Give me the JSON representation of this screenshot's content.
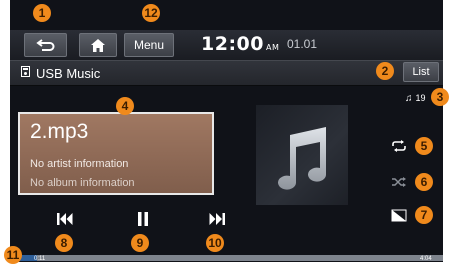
{
  "topbar": {
    "menu_label": "Menu",
    "clock_time": "12:00",
    "clock_ampm": "AM",
    "date": "01.01"
  },
  "source": {
    "title": "USB Music",
    "icon": "usb-music-icon"
  },
  "list_label": "List",
  "track_count": "19",
  "now_playing": {
    "file_name": "2.mp3",
    "artist": "No artist information",
    "album": "No album information",
    "elapsed": "0:11",
    "duration": "4:04",
    "progress": 0.045
  },
  "callouts": [
    "1",
    "2",
    "3",
    "4",
    "5",
    "6",
    "7",
    "8",
    "9",
    "10",
    "11",
    "12"
  ],
  "colors": {
    "callout": "#f08a1c",
    "progress_fill": "#2f5f99",
    "info_box": "#a07862"
  }
}
